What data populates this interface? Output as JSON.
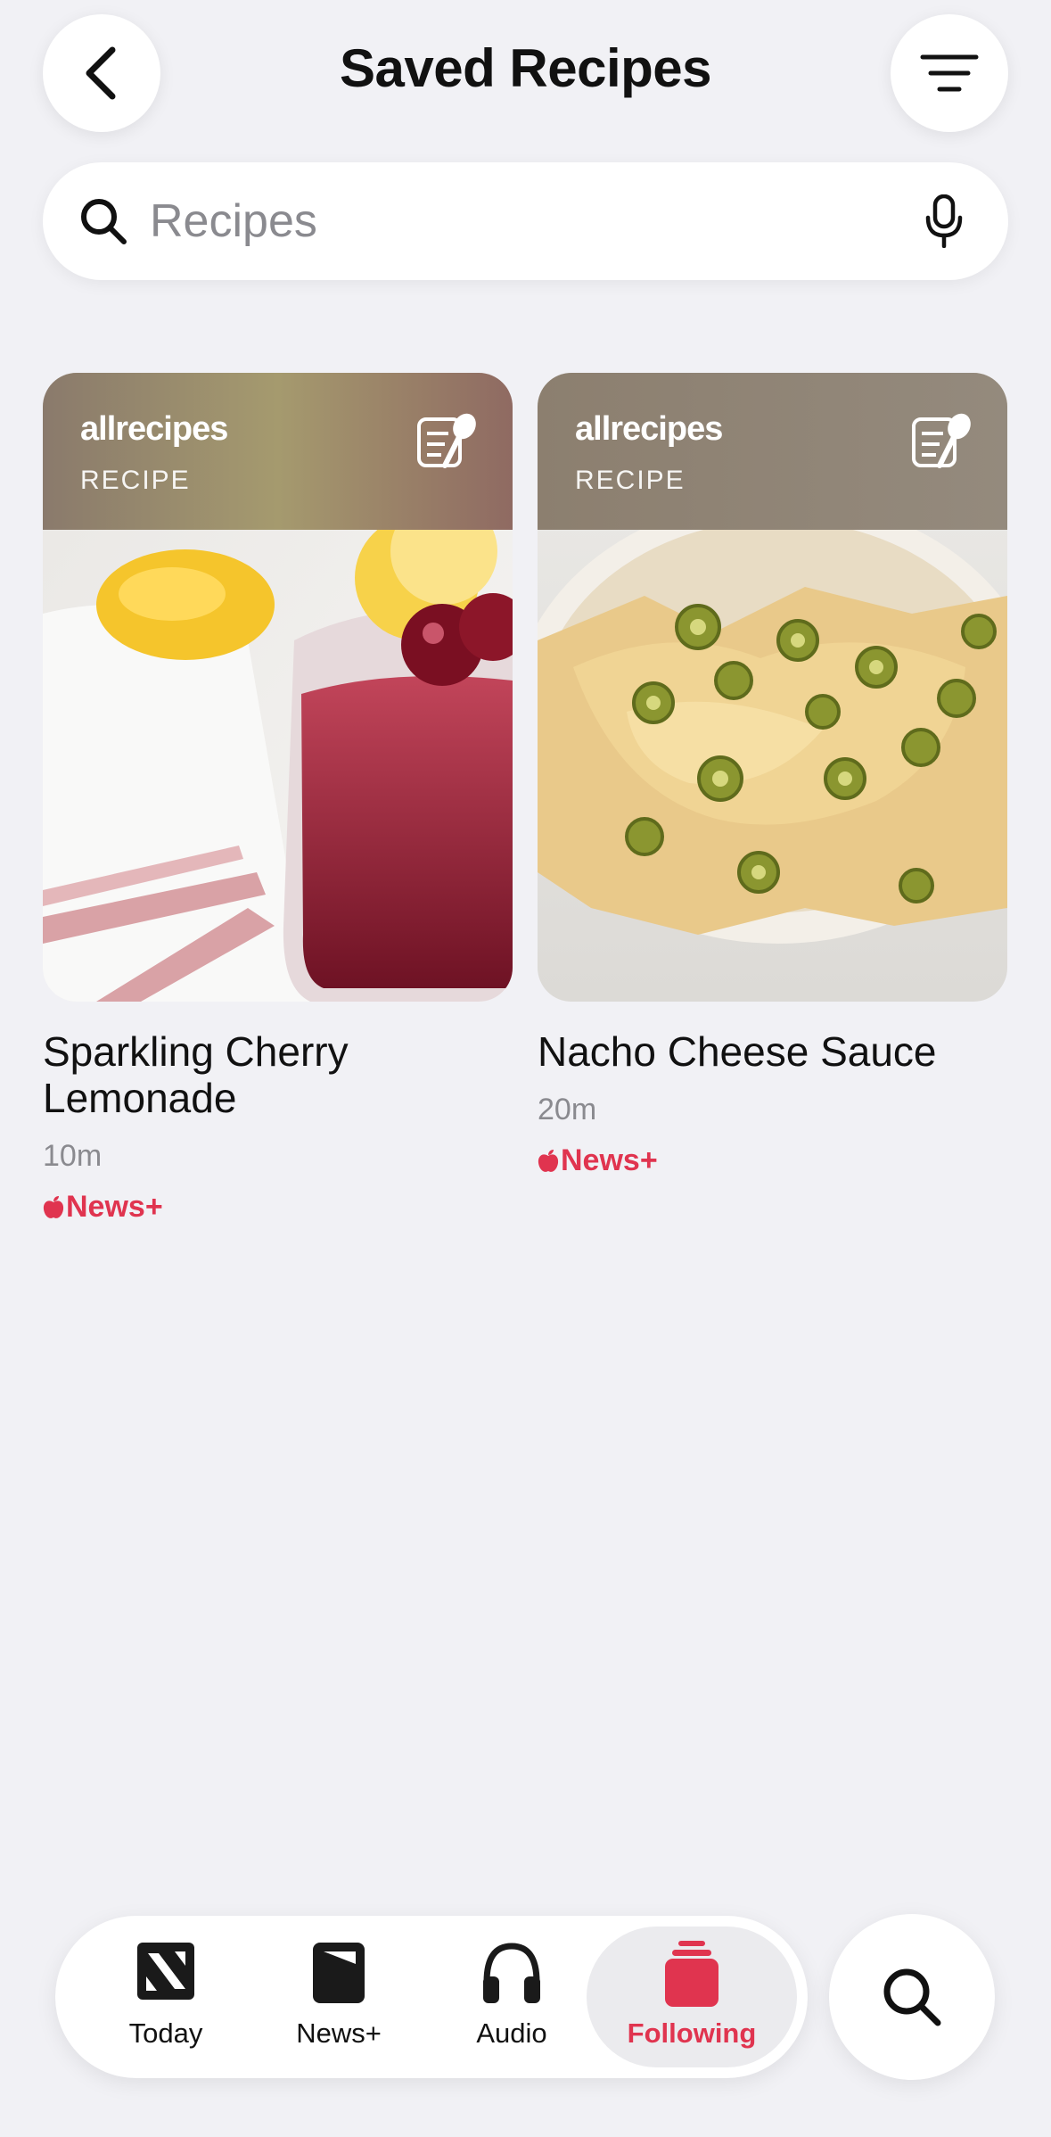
{
  "header": {
    "title": "Saved Recipes"
  },
  "search": {
    "placeholder": "Recipes"
  },
  "recipes": [
    {
      "brand": "allrecipes",
      "kind": "RECIPE",
      "title": "Sparkling Cherry Lemonade",
      "time": "10m",
      "badge": "News+"
    },
    {
      "brand": "allrecipes",
      "kind": "RECIPE",
      "title": "Nacho Cheese Sauce",
      "time": "20m",
      "badge": "News+"
    }
  ],
  "tabs": [
    {
      "label": "Today",
      "icon": "today-icon"
    },
    {
      "label": "News+",
      "icon": "newsplus-icon"
    },
    {
      "label": "Audio",
      "icon": "headphones-icon"
    },
    {
      "label": "Following",
      "icon": "following-icon",
      "selected": true
    }
  ],
  "colors": {
    "accent": "#e0344f",
    "background": "#f1f1f5"
  }
}
